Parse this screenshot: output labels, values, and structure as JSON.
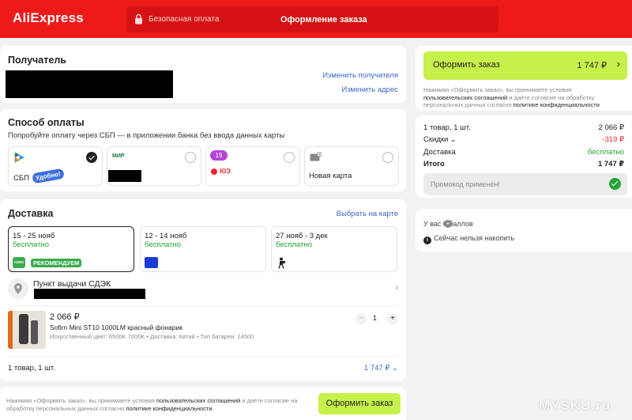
{
  "header": {
    "logo": "AliExpress",
    "secure_label": "Безопасная оплата",
    "title": "Оформление заказа",
    "colors": {
      "brand": "#ee1a1a",
      "accent_green": "#c6f04a"
    }
  },
  "recipient": {
    "title": "Получатель",
    "change_recipient": "Изменить получателя",
    "change_address": "Изменить адрес"
  },
  "payment": {
    "title": "Способ оплаты",
    "subtitle": "Попробуйте оплату через СБП — в приложении банка без ввода данных карты",
    "options": [
      {
        "label": "СБП",
        "badge": "Удобно!",
        "selected": true
      },
      {
        "label": "МИР",
        "selected": false
      },
      {
        "label": "ЮЭ",
        "badge": "19",
        "selected": false
      },
      {
        "label": "Новая карта",
        "selected": false
      }
    ]
  },
  "delivery": {
    "title": "Доставка",
    "choose_on_map": "Выбрать на карте",
    "options": [
      {
        "dates": "15 - 25 нояб",
        "price": "бесплатно",
        "carrier": "CDEK",
        "badge": "РЕКОМЕНДУЕМ",
        "selected": true
      },
      {
        "dates": "12 - 14 нояб",
        "price": "бесплатно",
        "carrier": "Почта России",
        "selected": false
      },
      {
        "dates": "27 нояб - 3 дек",
        "price": "бесплатно",
        "carrier": "courier",
        "selected": false
      }
    ],
    "pickup_label": "Пункт выдачи СДЭК"
  },
  "product": {
    "price": "2 066 ₽",
    "name": "Sofirn Mini ST10 1000LM красный фонарик",
    "meta": "Искусственный цвет: 6500K 7000K • Доставка: Китай • Тип батареи: 14500",
    "qty": "1",
    "minus": "−",
    "plus": "+"
  },
  "footer_summary": {
    "count": "1 товар, 1 шт.",
    "total": "1 747 ₽"
  },
  "bottom_bar": {
    "legal_pre": "Нажимая «Оформить заказ», вы принимаете условия ",
    "legal_link1": "пользовательских соглашений",
    "legal_mid": " и даёте согласие на обработку персональных данных согласно ",
    "legal_link2": "политике конфиденциальности",
    "button": "Оформить заказ"
  },
  "sidebar": {
    "order_button_label": "Оформить заказ",
    "order_button_total": "1 747 ₽",
    "legal_pre": "Нажимая «Оформить заказ», вы принимаете условия ",
    "legal_link1": "пользовательских соглашений",
    "legal_mid": " и даёте согласие на обработку персональных данных согласно ",
    "legal_link2": "политике конфиденциальности",
    "lines": [
      {
        "label": "1 товар, 1 шт.",
        "value": "2 066 ₽"
      },
      {
        "label": "Скидки",
        "value": "-319 ₽"
      },
      {
        "label": "Доставка",
        "value": "бесплатно"
      },
      {
        "label": "Итого",
        "value": "1 747 ₽"
      }
    ],
    "promo": "Промокод применён!",
    "points": "У вас  0 баллов",
    "cant_accumulate": "Сейчас нельзя накопить"
  },
  "watermark": "MYSKU.ru"
}
